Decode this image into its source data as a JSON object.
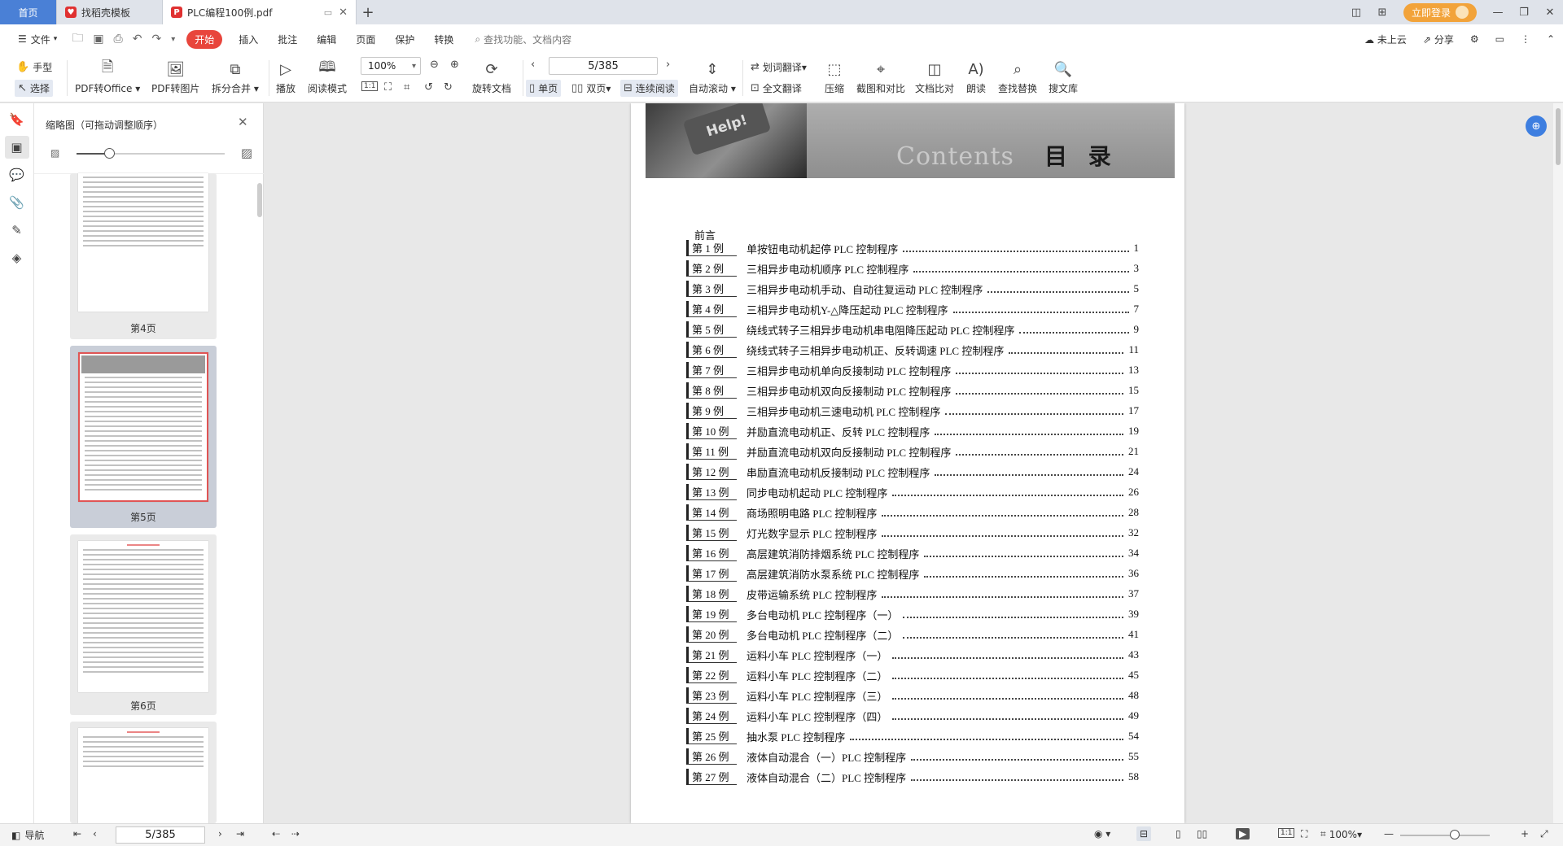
{
  "tabs": [
    {
      "label": "首页"
    },
    {
      "label": "找稻壳模板"
    },
    {
      "label": "PLC编程100例.pdf"
    }
  ],
  "window": {
    "login_label": "立即登录"
  },
  "menu": {
    "file": "文件",
    "items": [
      "开始",
      "插入",
      "批注",
      "编辑",
      "页面",
      "保护",
      "转换"
    ],
    "search_placeholder": "查找功能、文档内容",
    "cloud": "未上云",
    "share": "分享"
  },
  "ribbon": {
    "hand": "手型",
    "select": "选择",
    "pdf_to_office": "PDF转Office",
    "pdf_to_image": "PDF转图片",
    "split_merge": "拆分合并",
    "play": "播放",
    "read_mode": "阅读模式",
    "zoom_value": "100%",
    "rotate": "旋转文档",
    "page_value": "5/385",
    "single": "单页",
    "double": "双页",
    "continuous": "连续阅读",
    "auto_scroll": "自动滚动",
    "word_translate": "划词翻译",
    "full_translate": "全文翻译",
    "compress": "压缩",
    "screenshot_compare": "截图和对比",
    "doc_compare": "文档比对",
    "read_aloud": "朗读",
    "find_replace": "查找替换",
    "search_library": "搜文库"
  },
  "thumbnails": {
    "title": "缩略图（可拖动调整顺序）",
    "pages": [
      {
        "caption": "第4页"
      },
      {
        "caption": "第5页"
      },
      {
        "caption": "第6页"
      }
    ]
  },
  "document": {
    "banner_en": "Contents",
    "banner_cn": "目 录",
    "help_key": "Help!",
    "preface": "前言",
    "toc": [
      {
        "num": "第 1 例",
        "title": "单按钮电动机起停 PLC 控制程序",
        "page": "1"
      },
      {
        "num": "第 2 例",
        "title": "三相异步电动机顺序 PLC 控制程序",
        "page": "3"
      },
      {
        "num": "第 3 例",
        "title": "三相异步电动机手动、自动往复运动 PLC 控制程序",
        "page": "5"
      },
      {
        "num": "第 4 例",
        "title": "三相异步电动机Y-△降压起动 PLC 控制程序",
        "page": "7"
      },
      {
        "num": "第 5 例",
        "title": "绕线式转子三相异步电动机串电阻降压起动 PLC 控制程序",
        "page": "9"
      },
      {
        "num": "第 6 例",
        "title": "绕线式转子三相异步电动机正、反转调速 PLC 控制程序",
        "page": "11"
      },
      {
        "num": "第 7 例",
        "title": "三相异步电动机单向反接制动 PLC 控制程序",
        "page": "13"
      },
      {
        "num": "第 8 例",
        "title": "三相异步电动机双向反接制动 PLC 控制程序",
        "page": "15"
      },
      {
        "num": "第 9 例",
        "title": "三相异步电动机三速电动机 PLC 控制程序",
        "page": "17"
      },
      {
        "num": "第 10 例",
        "title": "并励直流电动机正、反转 PLC 控制程序",
        "page": "19"
      },
      {
        "num": "第 11 例",
        "title": "并励直流电动机双向反接制动 PLC 控制程序",
        "page": "21"
      },
      {
        "num": "第 12 例",
        "title": "串励直流电动机反接制动 PLC 控制程序",
        "page": "24"
      },
      {
        "num": "第 13 例",
        "title": "同步电动机起动 PLC 控制程序",
        "page": "26"
      },
      {
        "num": "第 14 例",
        "title": "商场照明电路 PLC 控制程序",
        "page": "28"
      },
      {
        "num": "第 15 例",
        "title": "灯光数字显示 PLC 控制程序",
        "page": "32"
      },
      {
        "num": "第 16 例",
        "title": "高层建筑消防排烟系统 PLC 控制程序",
        "page": "34"
      },
      {
        "num": "第 17 例",
        "title": "高层建筑消防水泵系统 PLC 控制程序",
        "page": "36"
      },
      {
        "num": "第 18 例",
        "title": "皮带运输系统 PLC 控制程序",
        "page": "37"
      },
      {
        "num": "第 19 例",
        "title": "多台电动机 PLC 控制程序（一）",
        "page": "39"
      },
      {
        "num": "第 20 例",
        "title": "多台电动机 PLC 控制程序（二）",
        "page": "41"
      },
      {
        "num": "第 21 例",
        "title": "运料小车 PLC 控制程序（一）",
        "page": "43"
      },
      {
        "num": "第 22 例",
        "title": "运料小车 PLC 控制程序（二）",
        "page": "45"
      },
      {
        "num": "第 23 例",
        "title": "运料小车 PLC 控制程序（三）",
        "page": "48"
      },
      {
        "num": "第 24 例",
        "title": "运料小车 PLC 控制程序（四）",
        "page": "49"
      },
      {
        "num": "第 25 例",
        "title": "抽水泵 PLC 控制程序",
        "page": "54"
      },
      {
        "num": "第 26 例",
        "title": "液体自动混合（一）PLC 控制程序",
        "page": "55"
      },
      {
        "num": "第 27 例",
        "title": "液体自动混合（二）PLC 控制程序",
        "page": "58"
      }
    ]
  },
  "status": {
    "nav": "导航",
    "page_value": "5/385",
    "zoom": "100%"
  }
}
